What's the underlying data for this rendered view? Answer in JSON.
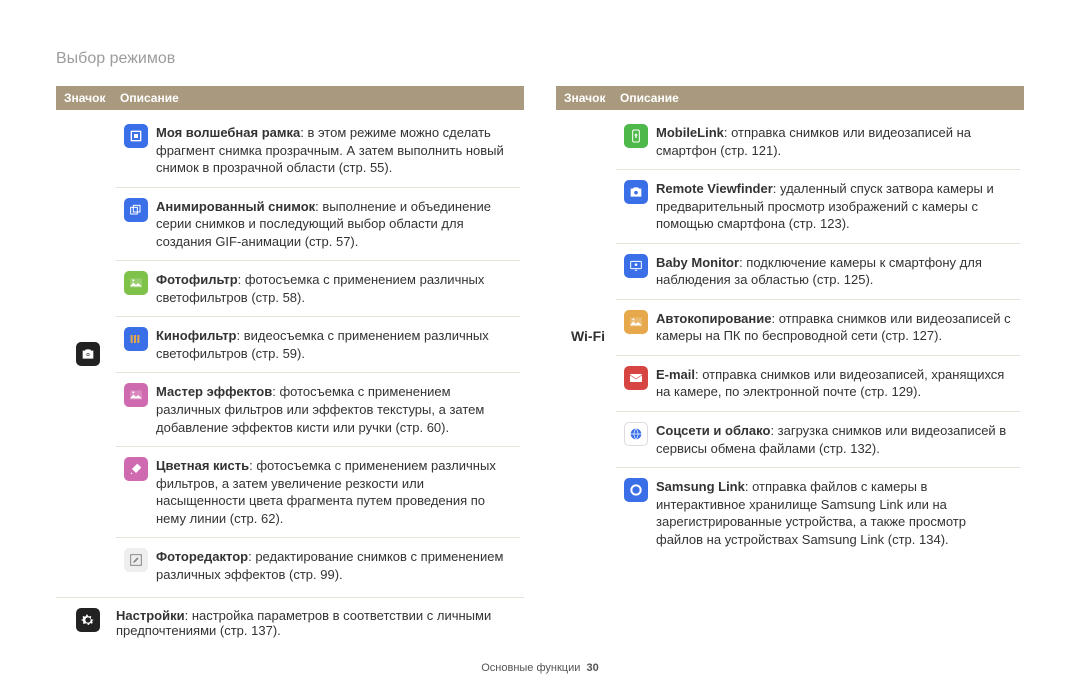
{
  "header": "Выбор режимов",
  "thead": {
    "icon": "Значок",
    "desc": "Описание"
  },
  "footer": {
    "section": "Основные функции",
    "page": "30"
  },
  "left": {
    "groupIcon": "camera-star-icon",
    "items": [
      {
        "icon": "magic-frame-icon",
        "bold": "Моя волшебная рамка",
        "text": ": в этом режиме можно сделать фрагмент снимка прозрачным. А затем выполнить новый снимок в прозрачной области (стр. 55)."
      },
      {
        "icon": "animated-icon",
        "bold": "Анимированный снимок",
        "text": ": выполнение и объединение серии снимков и последующий выбор области для создания GIF-анимации (стр. 57)."
      },
      {
        "icon": "photo-filter-icon",
        "bold": "Фотофильтр",
        "text": ": фотосъемка с применением различных светофильтров (стр. 58)."
      },
      {
        "icon": "movie-filter-icon",
        "bold": "Кинофильтр",
        "text": ": видеосъемка с применением различных светофильтров (стр. 59)."
      },
      {
        "icon": "effects-master-icon",
        "bold": "Мастер эффектов",
        "text": ": фотосъемка с применением различных фильтров или эффектов текстуры, а затем добавление эффектов кисти или ручки (стр. 60)."
      },
      {
        "icon": "color-brush-icon",
        "bold": "Цветная кисть",
        "text": ": фотосъемка с применением различных фильтров, а затем увеличение резкости или насыщенности цвета фрагмента путем проведения по нему линии (стр. 62)."
      },
      {
        "icon": "photo-editor-icon",
        "bold": "Фоторедактор",
        "text": ": редактирование снимков с применением различных эффектов (стр. 99)."
      }
    ],
    "settingsIcon": "settings-gear-icon",
    "settings": {
      "bold": "Настройки",
      "text": ": настройка параметров в соответствии с личными предпочтениями (стр. 137)."
    }
  },
  "right": {
    "groupLabel": "Wi-Fi",
    "items": [
      {
        "icon": "mobilelink-icon",
        "bold": "MobileLink",
        "text": ": отправка снимков или видеозаписей на смартфон (стр. 121)."
      },
      {
        "icon": "remote-viewfinder-icon",
        "bold": "Remote Viewfinder",
        "text": ": удаленный спуск затвора камеры и предварительный просмотр изображений с камеры с помощью смартфона (стр. 123)."
      },
      {
        "icon": "baby-monitor-icon",
        "bold": "Baby Monitor",
        "text": ": подключение камеры к смартфону для наблюдения за областью (стр. 125)."
      },
      {
        "icon": "autobackup-icon",
        "bold": "Автокопирование",
        "text": ": отправка снимков или видеозаписей с камеры на ПК по беспроводной сети (стр. 127)."
      },
      {
        "icon": "email-icon",
        "bold": "E-mail",
        "text": ": отправка снимков или видеозаписей, хранящихся на камере, по электронной почте (стр. 129)."
      },
      {
        "icon": "cloud-icon",
        "bold": "Соцсети и облако",
        "text": ": загрузка снимков или видеозаписей в сервисы обмена файлами (стр. 132)."
      },
      {
        "icon": "samsung-link-icon",
        "bold": "Samsung Link",
        "text": ": отправка файлов с камеры в интерактивное хранилище Samsung Link или на зарегистрированные устройства, а также просмотр файлов на устройствах Samsung Link (стр. 134)."
      }
    ]
  },
  "iconStyles": {
    "camera-star-icon": {
      "svg": "camera-star",
      "bg": "#222",
      "fg": "#fff"
    },
    "settings-gear-icon": {
      "svg": "gear",
      "bg": "#222",
      "fg": "#fff"
    },
    "magic-frame-icon": {
      "svg": "square",
      "bg": "#3a6fe8",
      "fg": "#fff"
    },
    "animated-icon": {
      "svg": "frames",
      "bg": "#3a6fe8",
      "fg": "#fff"
    },
    "photo-filter-icon": {
      "svg": "landscape",
      "bg": "#7fc24a",
      "fg": "#fff"
    },
    "movie-filter-icon": {
      "svg": "bars",
      "bg": "#3a6fe8",
      "fg": "#e6a84b"
    },
    "effects-master-icon": {
      "svg": "landscape",
      "bg": "#d06ab0",
      "fg": "#fff"
    },
    "color-brush-icon": {
      "svg": "brush",
      "bg": "#d06ab0",
      "fg": "#fff"
    },
    "photo-editor-icon": {
      "svg": "edit-frame",
      "bg": "#eee",
      "fg": "#888"
    },
    "mobilelink-icon": {
      "svg": "phone-arrow",
      "bg": "#4fb84a",
      "fg": "#fff"
    },
    "remote-viewfinder-icon": {
      "svg": "camera",
      "bg": "#3a6fe8",
      "fg": "#fff"
    },
    "baby-monitor-icon": {
      "svg": "monitor",
      "bg": "#3a6fe8",
      "fg": "#fff"
    },
    "autobackup-icon": {
      "svg": "landscape",
      "bg": "#e6a84b",
      "fg": "#fff"
    },
    "email-icon": {
      "svg": "mail",
      "bg": "#d64541",
      "fg": "#fff"
    },
    "cloud-icon": {
      "svg": "globe",
      "bg": "#ffffff",
      "fg": "#3a6fe8"
    },
    "samsung-link-icon": {
      "svg": "ring",
      "bg": "#3a6fe8",
      "fg": "#fff"
    }
  }
}
